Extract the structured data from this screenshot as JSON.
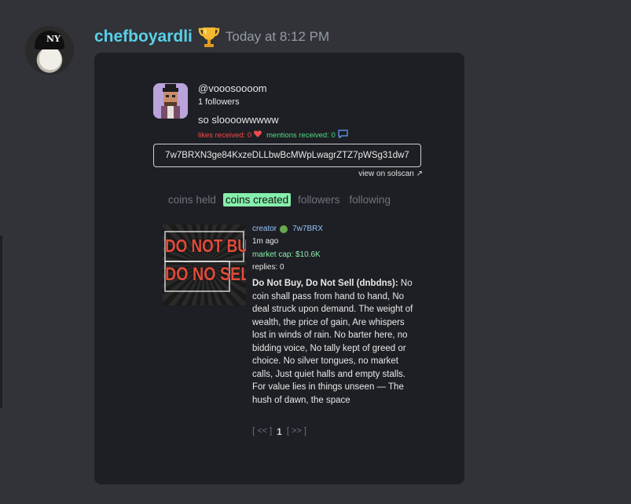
{
  "message": {
    "username": "chefboyardli",
    "badge_icon": "trophy-icon",
    "timestamp": "Today at 8:12 PM"
  },
  "profile": {
    "handle": "@vooosoooom",
    "followers": "1 followers",
    "bio": "so sloooowwwww",
    "likes": "likes received: 0",
    "mentions": "mentions received: 0",
    "address": "7w7BRXN3ge84KxzeDLLbwBcMWpLwagrZTZ7pWSg31dw7",
    "solscan": "view on solscan ↗"
  },
  "tabs": [
    {
      "label": "coins held",
      "active": false
    },
    {
      "label": "coins created",
      "active": true
    },
    {
      "label": "followers",
      "active": false
    },
    {
      "label": "following",
      "active": false
    }
  ],
  "coin": {
    "image_line1": "DO NOT BUY",
    "image_line2": "DO NO SELL",
    "creator_label": "creator",
    "creator_value": "7w7BRX",
    "ago": "1m ago",
    "market_cap": "market cap: $10.6K",
    "replies": "replies: 0",
    "title": "Do Not Buy, Do Not Sell (dnbdns):",
    "description": "No coin shall pass from hand to hand, No deal struck upon demand. The weight of wealth, the price of gain, Are whispers lost in winds of rain. No barter here, no bidding voice, No tally kept of greed or choice. No silver tongues, no market calls, Just quiet halls and empty stalls. For value lies in things unseen — The hush of dawn, the space"
  },
  "pager": {
    "prev": "[ << ]",
    "current": "1",
    "next": "[ >> ]"
  },
  "colors": {
    "username": "#5ad0e8",
    "active_tab": "#86efac",
    "likes": "#f04b4b",
    "mentions": "#4ade80",
    "creator": "#93c5fd"
  }
}
